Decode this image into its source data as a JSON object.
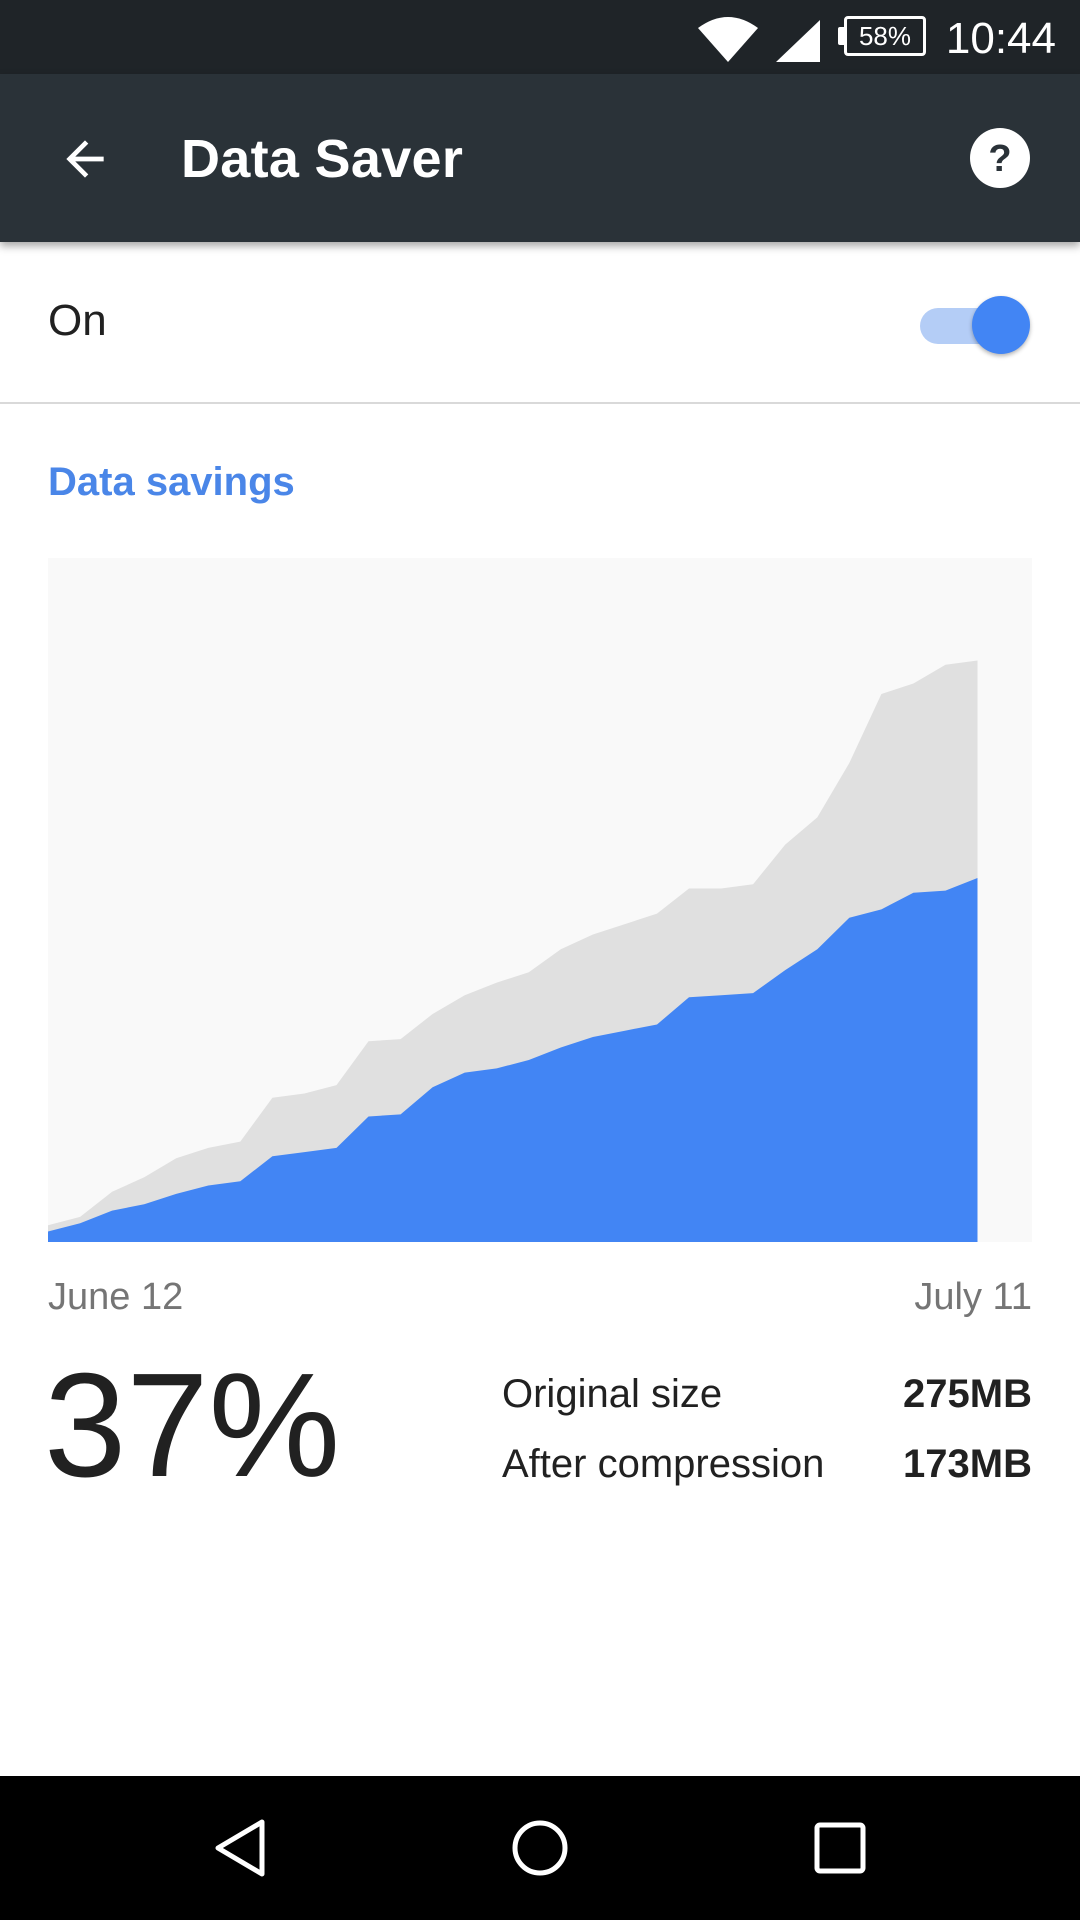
{
  "status_bar": {
    "time": "10:44",
    "battery_percent": "58%",
    "icons": [
      "wifi-icon",
      "cell-signal-icon",
      "battery-icon"
    ]
  },
  "app_bar": {
    "title": "Data Saver",
    "back_icon": "arrow-back-icon",
    "help_icon": "help-icon"
  },
  "toggle": {
    "label": "On",
    "checked": true,
    "accent": "#4285f4"
  },
  "savings": {
    "section_title": "Data savings",
    "start_date": "June 12",
    "end_date": "July 11",
    "percent": "37%",
    "original_label": "Original size",
    "original_value": "275MB",
    "compressed_label": "After compression",
    "compressed_value": "173MB"
  },
  "chart_data": {
    "type": "area",
    "title": "",
    "xlabel": "",
    "ylabel": "",
    "x": [
      "June 12",
      "",
      "",
      "",
      "",
      "",
      "",
      "",
      "",
      "",
      "",
      "",
      "",
      "",
      "",
      "",
      "",
      "",
      "",
      "",
      "",
      "",
      "",
      "",
      "",
      "",
      "",
      "",
      "",
      "July 11"
    ],
    "xlim": [
      0,
      30.7
    ],
    "ylim": [
      0,
      327
    ],
    "grid": false,
    "series": [
      {
        "color": "#e0e0e0",
        "values": [
          8,
          12,
          24,
          31,
          40,
          45,
          48,
          69,
          71,
          75,
          96,
          97,
          109,
          118,
          124,
          129,
          140,
          147,
          152,
          157,
          169,
          169,
          171,
          190,
          203,
          229,
          262,
          267,
          276,
          278
        ]
      },
      {
        "color": "#4285f4",
        "values": [
          5,
          9,
          15,
          18,
          23,
          27,
          29,
          41,
          43,
          45,
          60,
          61,
          74,
          81,
          83,
          87,
          93,
          98,
          101,
          104,
          117,
          118,
          119,
          130,
          140,
          155,
          159,
          167,
          168,
          174
        ]
      }
    ],
    "background": "#f9f9f9"
  },
  "nav_bar": {
    "buttons": [
      "nav-back-icon",
      "nav-home-icon",
      "nav-recents-icon"
    ]
  }
}
